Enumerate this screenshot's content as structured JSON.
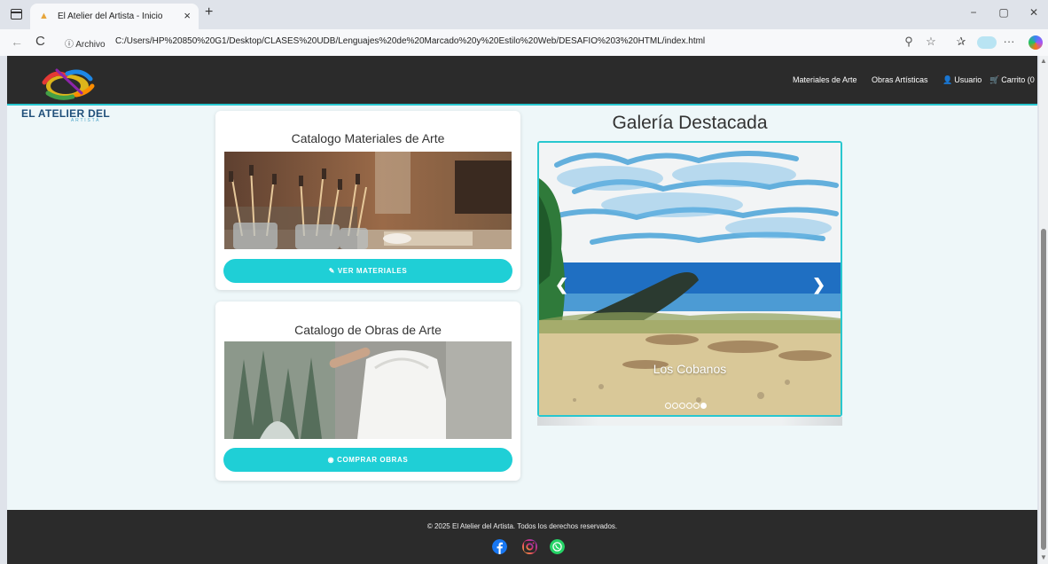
{
  "browser": {
    "tab_title": "El Atelier del Artista - Inicio",
    "tab_close": "×",
    "new_tab": "+",
    "site_info": "ⓘ Archivo",
    "url": "C:/Users/HP%20850%20G1/Desktop/CLASES%20UDB/Lenguajes%20de%20Marcado%20y%20Estilo%20Web/DESAFIO%203%20HTML/index.html",
    "icons": [
      "zoom-icon",
      "favorite-star-icon",
      "favorites-icon",
      "profile-icon",
      "more-icon",
      "copilot-icon"
    ],
    "more_label": "···",
    "back_glyph": "←",
    "reload_glyph": "C",
    "window_minimize": "−",
    "window_restore": "▢",
    "window_close": "✕"
  },
  "header": {
    "logo_text": "EL ATELIER DEL",
    "logo_subtext": "ARTISTA",
    "nav": {
      "materiales": "Materiales de Arte",
      "obras": "Obras Artísticas",
      "usuario": "Usuario",
      "carrito": "Carrito (0"
    }
  },
  "cards": {
    "materiales": {
      "title": "Catalogo Materiales de Arte",
      "button": "VER MATERIALES",
      "button_icon": "pencil-icon"
    },
    "obras": {
      "title": "Catalogo de Obras de Arte",
      "button": "COMPRAR OBRAS",
      "button_icon": "eye-icon"
    }
  },
  "gallery": {
    "title": "Galería Destacada",
    "caption": "Los Cobanos",
    "slide_count": 6,
    "active_slide": 6
  },
  "footer": {
    "copyright": "© 2025 El Atelier del Artista. Todos los derechos reservados.",
    "social": [
      "facebook-icon",
      "instagram-icon",
      "whatsapp-icon"
    ]
  },
  "colors": {
    "accent": "#1fcfd6",
    "header_bg": "#2b2b2b",
    "page_bg": "#eef7f9"
  }
}
